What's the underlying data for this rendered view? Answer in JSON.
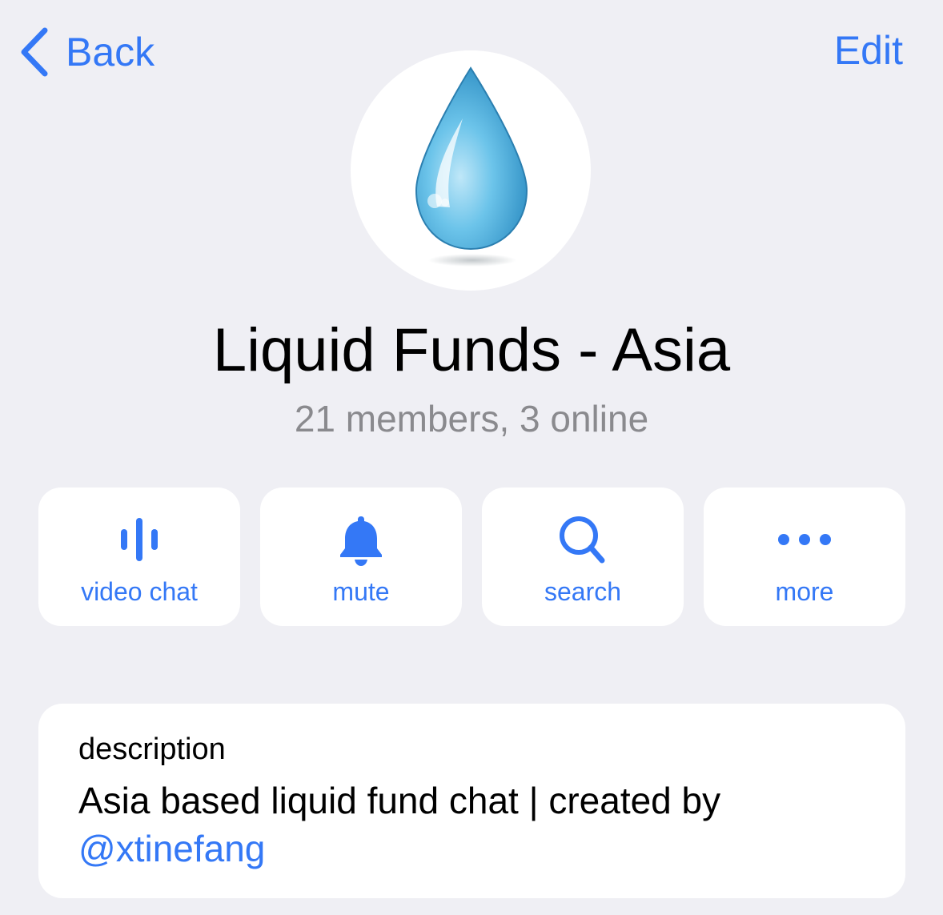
{
  "nav": {
    "back_label": "Back",
    "edit_label": "Edit"
  },
  "group": {
    "title": "Liquid Funds - Asia",
    "subtitle": "21 members, 3 online"
  },
  "actions": [
    {
      "label": "video chat",
      "icon": "voice-wave-icon"
    },
    {
      "label": "mute",
      "icon": "bell-icon"
    },
    {
      "label": "search",
      "icon": "search-icon"
    },
    {
      "label": "more",
      "icon": "ellipsis-icon"
    }
  ],
  "description": {
    "heading": "description",
    "text": "Asia based liquid fund chat | created by",
    "link": "@xtinefang"
  },
  "colors": {
    "accent": "#3478f6",
    "background": "#efeff4",
    "card": "#ffffff",
    "secondary_text": "#8a8a8e"
  }
}
